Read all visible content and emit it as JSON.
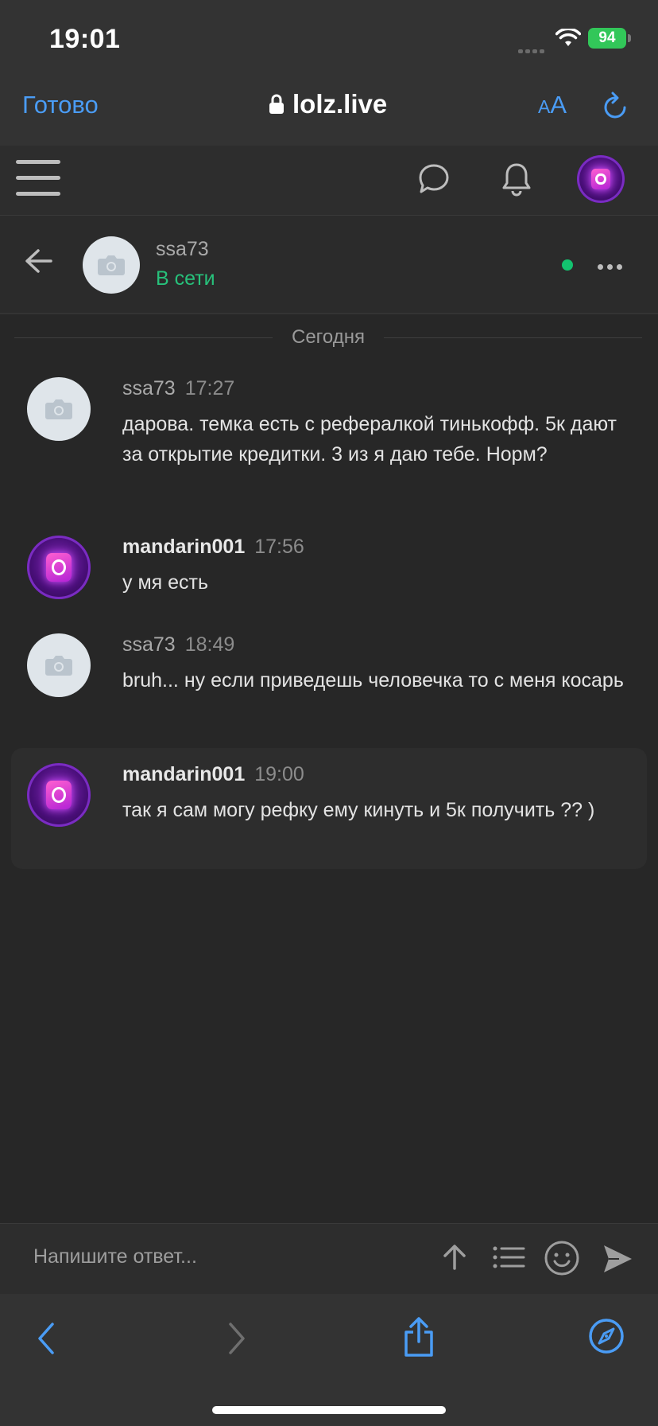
{
  "status_bar": {
    "time": "19:01",
    "battery": "94"
  },
  "safari": {
    "done_label": "Готово",
    "url": "lolz.live",
    "text_size_small": "A",
    "text_size_large": "A"
  },
  "conversation": {
    "partner_name": "ssa73",
    "partner_status": "В сети",
    "date_divider": "Сегодня"
  },
  "messages": [
    {
      "author": "ssa73",
      "time": "17:27",
      "text": "дарова. темка есть с рефералкой тинькофф. 5к дают за открытие кредитки. 3 из я даю тебе. Норм?",
      "avatar": "placeholder"
    },
    {
      "author": "mandarin001",
      "time": "17:56",
      "text": "у мя есть",
      "avatar": "purple"
    },
    {
      "author": "ssa73",
      "time": "18:49",
      "text": "bruh... ну если приведешь человечка то с меня косарь",
      "avatar": "placeholder"
    },
    {
      "author": "mandarin001",
      "time": "19:00",
      "text": "так я сам могу рефку ему кинуть и 5к получить ?? )",
      "avatar": "purple"
    }
  ],
  "reply": {
    "placeholder": "Напишите ответ..."
  },
  "icons": {
    "header": [
      "menu-icon",
      "chat-bubble-icon",
      "bell-icon",
      "user-avatar"
    ],
    "reply_bar": [
      "arrow-up-icon",
      "list-icon",
      "smiley-icon",
      "send-icon"
    ],
    "bottom_bar": [
      "back-chevron-icon",
      "forward-chevron-icon",
      "share-icon",
      "compass-icon"
    ]
  },
  "colors": {
    "link_blue": "#4a9cf5",
    "online_green": "#27c17b",
    "background": "#272727"
  }
}
